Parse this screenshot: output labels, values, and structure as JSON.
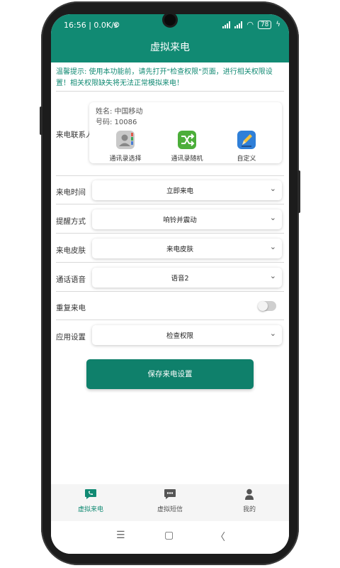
{
  "status_bar": {
    "time_speed": "16:56 | 0.0K/s",
    "battery": "78"
  },
  "app_bar": {
    "title": "虚拟来电"
  },
  "tip": "温馨提示: 使用本功能前，请先打开\"检查权限\"页面，进行相关权限设置！相关权限缺失将无法正常模拟来电！",
  "contact": {
    "label": "来电联系人",
    "name": "姓名: 中国移动",
    "number": "号码: 10086",
    "options": [
      {
        "label": "通讯录选择",
        "icon": "contact-book-icon"
      },
      {
        "label": "通讯录随机",
        "icon": "shuffle-icon"
      },
      {
        "label": "自定义",
        "icon": "pencil-icon"
      }
    ]
  },
  "settings": [
    {
      "label": "来电时间",
      "value": "立即来电"
    },
    {
      "label": "提醒方式",
      "value": "响铃并震动"
    },
    {
      "label": "来电皮肤",
      "value": "来电皮肤"
    },
    {
      "label": "通话语音",
      "value": "语音2"
    }
  ],
  "repeat": {
    "label": "重复来电",
    "enabled": false
  },
  "app_settings": {
    "label": "应用设置",
    "value": "检查权限"
  },
  "save_button": "保存来电设置",
  "bottom_nav": [
    {
      "label": "虚拟来电",
      "icon": "phone-chat-icon",
      "active": true
    },
    {
      "label": "虚拟短信",
      "icon": "message-icon",
      "active": false
    },
    {
      "label": "我的",
      "icon": "person-icon",
      "active": false
    }
  ],
  "colors": {
    "brand": "#118a73",
    "button": "#0f806b"
  }
}
